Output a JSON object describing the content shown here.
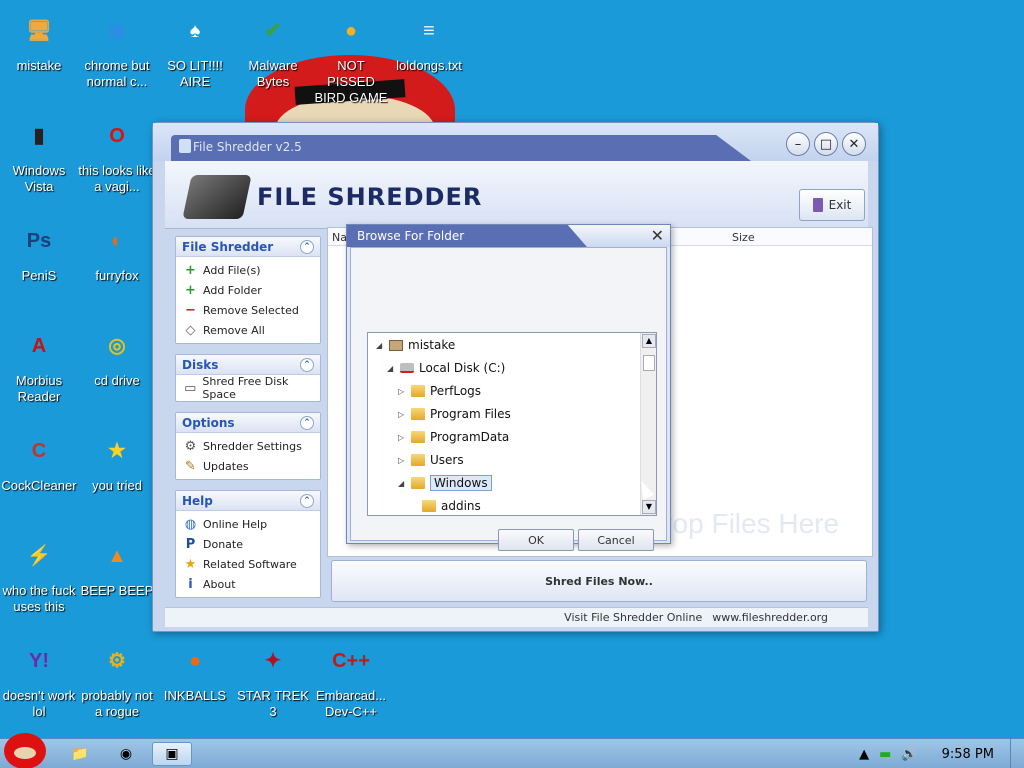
{
  "desktop": {
    "icons": [
      {
        "label": "mistake",
        "icon": "computer-icon",
        "color": "#f2a93b"
      },
      {
        "label": "chrome but normal c...",
        "icon": "chrome-icon",
        "color": "#2b8de3"
      },
      {
        "label": "SO LIT!!!! AIRE",
        "icon": "solitaire-icon",
        "color": "#ffffff"
      },
      {
        "label": "Malware Bytes",
        "icon": "shield-icon",
        "color": "#3aa13a"
      },
      {
        "label": "NOT PISSED BIRD GAME",
        "icon": "pig-icon",
        "color": "#f6b21e"
      },
      {
        "label": "loldongs.txt",
        "icon": "text-file-icon",
        "color": "#f4f4f4"
      },
      {
        "label": "Windows Vista",
        "icon": "vista-icon",
        "color": "#222222"
      },
      {
        "label": "this looks like a vagi...",
        "icon": "opera-icon",
        "color": "#d91313"
      },
      {
        "label": "PeniS",
        "icon": "photoshop-icon",
        "color": "#1d3f7a"
      },
      {
        "label": "furryfox",
        "icon": "firefox-icon",
        "color": "#e86a1a"
      },
      {
        "label": "Morbius Reader",
        "icon": "pdf-icon",
        "color": "#c8120f"
      },
      {
        "label": "cd drive",
        "icon": "cd-icon",
        "color": "#e8c21a"
      },
      {
        "label": "CockCleaner",
        "icon": "ccleaner-icon",
        "color": "#c0352a"
      },
      {
        "label": "you tried",
        "icon": "star-icon",
        "color": "#ffd21f"
      },
      {
        "label": "who the fuck uses this",
        "icon": "winamp-icon",
        "color": "#ffffff"
      },
      {
        "label": "BEEP BEEP",
        "icon": "vlc-icon",
        "color": "#f08a1a"
      },
      {
        "label": "doesn't work lol",
        "icon": "yahoo-icon",
        "color": "#6b2ca3"
      },
      {
        "label": "probably not a rogue",
        "icon": "gear-icon",
        "color": "#e9b21b"
      },
      {
        "label": "INKBALLS",
        "icon": "inkball-icon",
        "color": "#ee6a12"
      },
      {
        "label": "STAR TREK 3",
        "icon": "star-wars-icon",
        "color": "#b3121d"
      },
      {
        "label": "Embarcad... Dev-C++",
        "icon": "devcpp-icon",
        "color": "#c01b1b"
      }
    ]
  },
  "taskbar": {
    "start_icon": "angry-bird-icon",
    "pinned": [
      "folder-icon",
      "chrome-icon",
      "file-shredder-icon"
    ],
    "clock": "9:58 PM"
  },
  "window": {
    "title": "File Shredder v2.5",
    "logo_text": "FILE SHREDDER",
    "exit_label": "Exit",
    "panels": [
      {
        "title": "File Shredder",
        "items": [
          {
            "label": "Add File(s)",
            "icon": "plus-icon"
          },
          {
            "label": "Add Folder",
            "icon": "plus-icon"
          },
          {
            "label": "Remove Selected",
            "icon": "minus-icon"
          },
          {
            "label": "Remove All",
            "icon": "eraser-icon"
          }
        ]
      },
      {
        "title": "Disks",
        "items": [
          {
            "label": "Shred Free Disk Space",
            "icon": "disk-icon"
          }
        ]
      },
      {
        "title": "Options",
        "items": [
          {
            "label": "Shredder Settings",
            "icon": "settings-icon"
          },
          {
            "label": "Updates",
            "icon": "updates-icon"
          }
        ]
      },
      {
        "title": "Help",
        "items": [
          {
            "label": "Online Help",
            "icon": "globe-icon"
          },
          {
            "label": "Donate",
            "icon": "paypal-icon"
          },
          {
            "label": "Related Software",
            "icon": "star-icon"
          },
          {
            "label": "About",
            "icon": "info-icon"
          }
        ]
      }
    ],
    "columns": [
      "Na",
      "Size"
    ],
    "drop_hint": "Drop Files Here",
    "shred_button": "Shred Files Now..",
    "status_left": "Visit File Shredder Online",
    "status_url": "www.fileshredder.org"
  },
  "dialog": {
    "title": "Browse For Folder",
    "tree": [
      {
        "label": "mistake",
        "level": 0,
        "icon": "computer-icon",
        "expanded": true
      },
      {
        "label": "Local Disk (C:)",
        "level": 1,
        "icon": "disk-icon",
        "expanded": true
      },
      {
        "label": "PerfLogs",
        "level": 2,
        "icon": "folder-icon",
        "expanded": false
      },
      {
        "label": "Program Files",
        "level": 2,
        "icon": "folder-icon",
        "expanded": false
      },
      {
        "label": "ProgramData",
        "level": 2,
        "icon": "folder-icon",
        "expanded": false
      },
      {
        "label": "Users",
        "level": 2,
        "icon": "folder-icon",
        "expanded": false
      },
      {
        "label": "Windows",
        "level": 2,
        "icon": "folder-icon",
        "expanded": true,
        "selected": true
      },
      {
        "label": "addins",
        "level": 3,
        "icon": "folder-icon",
        "expanded": false
      }
    ],
    "ok_label": "OK",
    "cancel_label": "Cancel"
  }
}
